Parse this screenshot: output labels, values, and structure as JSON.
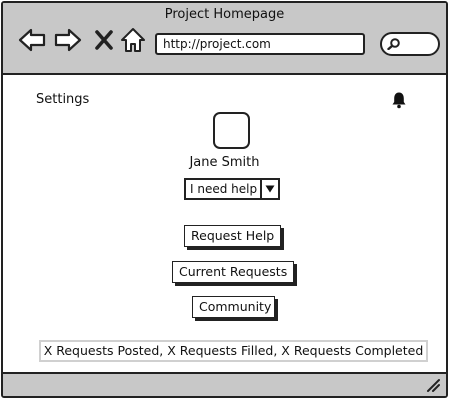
{
  "window": {
    "title": "Project Homepage"
  },
  "toolbar": {
    "back_icon": "back-arrow-icon",
    "forward_icon": "forward-arrow-icon",
    "stop_icon": "close-icon",
    "home_icon": "home-icon",
    "url": "http://project.com",
    "search_icon": "search-icon"
  },
  "header": {
    "settings_label": "Settings",
    "notification_icon": "bell-icon"
  },
  "profile": {
    "name": "Jane Smith",
    "status_selected": "I need help"
  },
  "actions": {
    "request_help": "Request Help",
    "current_requests": "Current Requests",
    "community": "Community"
  },
  "stats": {
    "summary": "X Requests Posted, X Requests Filled, X Requests Completed"
  },
  "colors": {
    "chrome": "#c8c8c8",
    "border": "#222222",
    "stats_border": "#d0d0d0"
  }
}
